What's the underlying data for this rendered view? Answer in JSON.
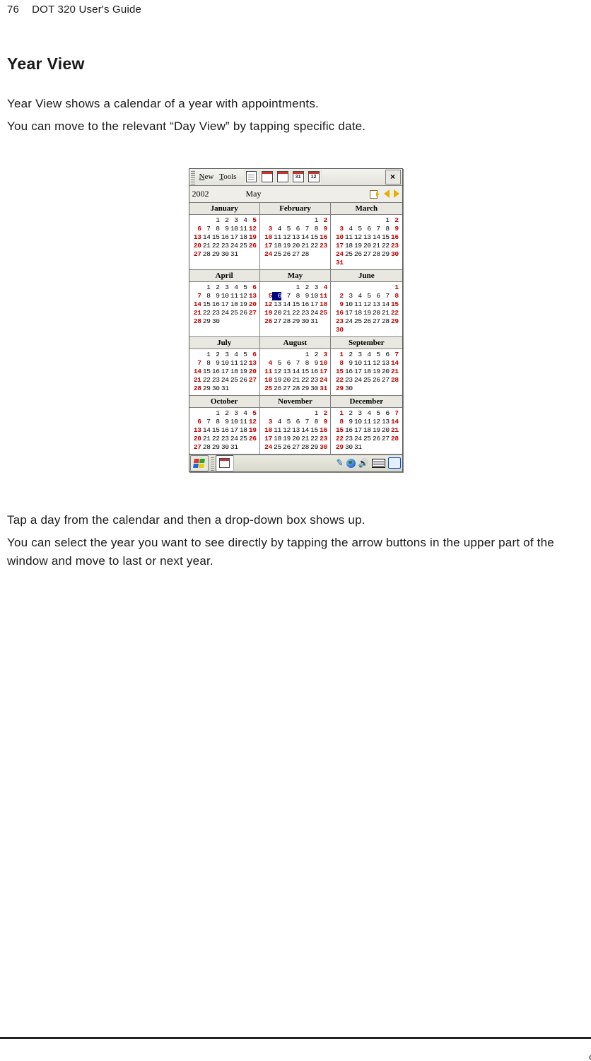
{
  "page_number": "76",
  "book_title": "DOT 320 User's Guide",
  "section_title": "Year View",
  "para1": "Year View shows a calendar of a year with appointments.",
  "para2": "You can move to the relevant “Day View” by tapping specific date.",
  "para3": "Tap a day from the calendar and then a drop-down box shows up.",
  "para4": "You can select the year you want to see directly by tapping the arrow buttons in the upper part of the window and move to last or next year.",
  "device": {
    "menu_new": "New",
    "menu_tools": "Tools",
    "toolbar_day4_badge": "31",
    "toolbar_year_badge": "12",
    "close": "×",
    "year": "2002",
    "month": "May",
    "tray_letter": "C"
  },
  "months": [
    {
      "name": "January",
      "start": 2,
      "len": 31,
      "sun": [
        6,
        13,
        20,
        27
      ],
      "sat": [
        5,
        12,
        19,
        26
      ]
    },
    {
      "name": "February",
      "start": 5,
      "len": 28,
      "sun": [
        3,
        10,
        17,
        24
      ],
      "sat": [
        2,
        9,
        16,
        23
      ]
    },
    {
      "name": "March",
      "start": 5,
      "len": 31,
      "sun": [
        3,
        10,
        17,
        24,
        31
      ],
      "sat": [
        2,
        9,
        16,
        23,
        30
      ]
    },
    {
      "name": "April",
      "start": 1,
      "len": 30,
      "sun": [
        7,
        14,
        21,
        28
      ],
      "sat": [
        6,
        13,
        20,
        27
      ]
    },
    {
      "name": "May",
      "start": 3,
      "len": 31,
      "sun": [
        5,
        12,
        19,
        26
      ],
      "sat": [
        4,
        11,
        18,
        25
      ],
      "sel": 6
    },
    {
      "name": "June",
      "start": 6,
      "len": 30,
      "sun": [
        2,
        9,
        16,
        23,
        30
      ],
      "sat": [
        1,
        8,
        15,
        22,
        29
      ]
    },
    {
      "name": "July",
      "start": 1,
      "len": 31,
      "sun": [
        7,
        14,
        21,
        28
      ],
      "sat": [
        6,
        13,
        20,
        27
      ]
    },
    {
      "name": "August",
      "start": 4,
      "len": 31,
      "sun": [
        4,
        11,
        18,
        25
      ],
      "sat": [
        3,
        10,
        17,
        24,
        31
      ]
    },
    {
      "name": "September",
      "start": 0,
      "len": 30,
      "sun": [
        1,
        8,
        15,
        22,
        29
      ],
      "sat": [
        7,
        14,
        21,
        28
      ]
    },
    {
      "name": "October",
      "start": 2,
      "len": 31,
      "sun": [
        6,
        13,
        20,
        27
      ],
      "sat": [
        5,
        12,
        19,
        26
      ]
    },
    {
      "name": "November",
      "start": 5,
      "len": 30,
      "sun": [
        3,
        10,
        17,
        24
      ],
      "sat": [
        2,
        9,
        16,
        23,
        30
      ]
    },
    {
      "name": "December",
      "start": 0,
      "len": 31,
      "sun": [
        1,
        8,
        15,
        22,
        29
      ],
      "sat": [
        7,
        14,
        21,
        28
      ]
    }
  ]
}
